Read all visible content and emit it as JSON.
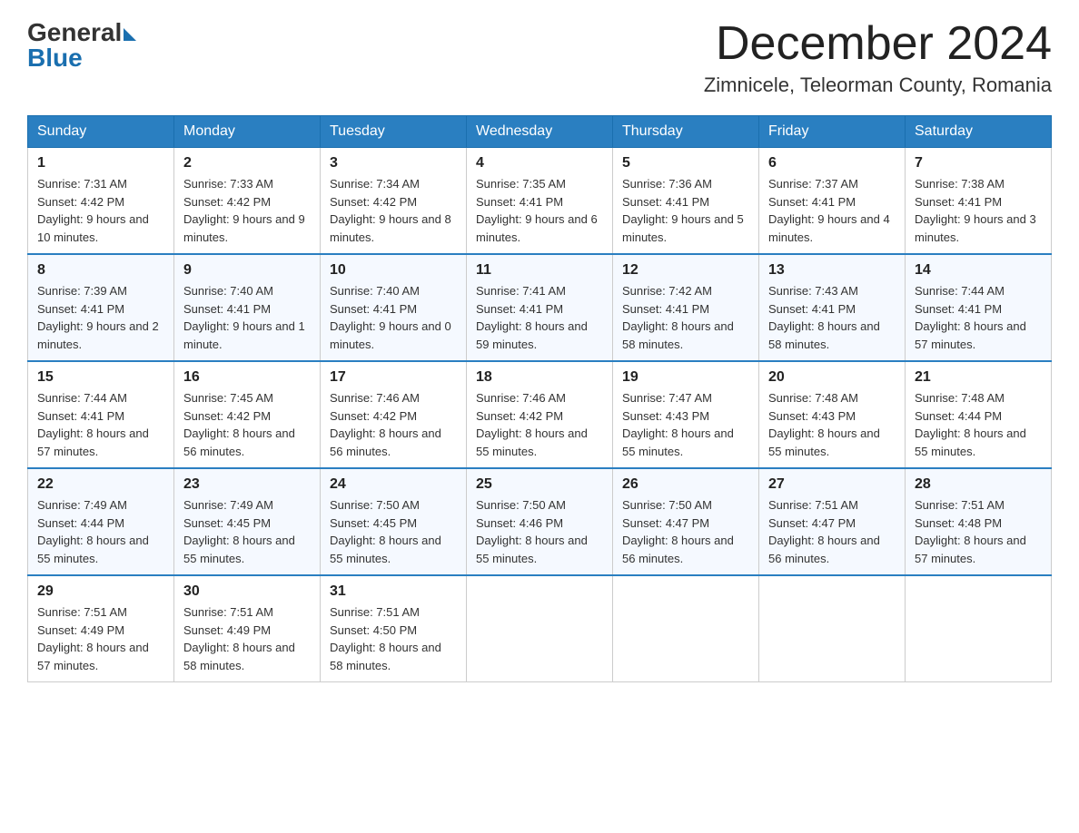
{
  "header": {
    "logo_general": "General",
    "logo_blue": "Blue",
    "month_title": "December 2024",
    "location": "Zimnicele, Teleorman County, Romania"
  },
  "days_of_week": [
    "Sunday",
    "Monday",
    "Tuesday",
    "Wednesday",
    "Thursday",
    "Friday",
    "Saturday"
  ],
  "weeks": [
    [
      {
        "num": "1",
        "sunrise": "7:31 AM",
        "sunset": "4:42 PM",
        "daylight": "9 hours and 10 minutes."
      },
      {
        "num": "2",
        "sunrise": "7:33 AM",
        "sunset": "4:42 PM",
        "daylight": "9 hours and 9 minutes."
      },
      {
        "num": "3",
        "sunrise": "7:34 AM",
        "sunset": "4:42 PM",
        "daylight": "9 hours and 8 minutes."
      },
      {
        "num": "4",
        "sunrise": "7:35 AM",
        "sunset": "4:41 PM",
        "daylight": "9 hours and 6 minutes."
      },
      {
        "num": "5",
        "sunrise": "7:36 AM",
        "sunset": "4:41 PM",
        "daylight": "9 hours and 5 minutes."
      },
      {
        "num": "6",
        "sunrise": "7:37 AM",
        "sunset": "4:41 PM",
        "daylight": "9 hours and 4 minutes."
      },
      {
        "num": "7",
        "sunrise": "7:38 AM",
        "sunset": "4:41 PM",
        "daylight": "9 hours and 3 minutes."
      }
    ],
    [
      {
        "num": "8",
        "sunrise": "7:39 AM",
        "sunset": "4:41 PM",
        "daylight": "9 hours and 2 minutes."
      },
      {
        "num": "9",
        "sunrise": "7:40 AM",
        "sunset": "4:41 PM",
        "daylight": "9 hours and 1 minute."
      },
      {
        "num": "10",
        "sunrise": "7:40 AM",
        "sunset": "4:41 PM",
        "daylight": "9 hours and 0 minutes."
      },
      {
        "num": "11",
        "sunrise": "7:41 AM",
        "sunset": "4:41 PM",
        "daylight": "8 hours and 59 minutes."
      },
      {
        "num": "12",
        "sunrise": "7:42 AM",
        "sunset": "4:41 PM",
        "daylight": "8 hours and 58 minutes."
      },
      {
        "num": "13",
        "sunrise": "7:43 AM",
        "sunset": "4:41 PM",
        "daylight": "8 hours and 58 minutes."
      },
      {
        "num": "14",
        "sunrise": "7:44 AM",
        "sunset": "4:41 PM",
        "daylight": "8 hours and 57 minutes."
      }
    ],
    [
      {
        "num": "15",
        "sunrise": "7:44 AM",
        "sunset": "4:41 PM",
        "daylight": "8 hours and 57 minutes."
      },
      {
        "num": "16",
        "sunrise": "7:45 AM",
        "sunset": "4:42 PM",
        "daylight": "8 hours and 56 minutes."
      },
      {
        "num": "17",
        "sunrise": "7:46 AM",
        "sunset": "4:42 PM",
        "daylight": "8 hours and 56 minutes."
      },
      {
        "num": "18",
        "sunrise": "7:46 AM",
        "sunset": "4:42 PM",
        "daylight": "8 hours and 55 minutes."
      },
      {
        "num": "19",
        "sunrise": "7:47 AM",
        "sunset": "4:43 PM",
        "daylight": "8 hours and 55 minutes."
      },
      {
        "num": "20",
        "sunrise": "7:48 AM",
        "sunset": "4:43 PM",
        "daylight": "8 hours and 55 minutes."
      },
      {
        "num": "21",
        "sunrise": "7:48 AM",
        "sunset": "4:44 PM",
        "daylight": "8 hours and 55 minutes."
      }
    ],
    [
      {
        "num": "22",
        "sunrise": "7:49 AM",
        "sunset": "4:44 PM",
        "daylight": "8 hours and 55 minutes."
      },
      {
        "num": "23",
        "sunrise": "7:49 AM",
        "sunset": "4:45 PM",
        "daylight": "8 hours and 55 minutes."
      },
      {
        "num": "24",
        "sunrise": "7:50 AM",
        "sunset": "4:45 PM",
        "daylight": "8 hours and 55 minutes."
      },
      {
        "num": "25",
        "sunrise": "7:50 AM",
        "sunset": "4:46 PM",
        "daylight": "8 hours and 55 minutes."
      },
      {
        "num": "26",
        "sunrise": "7:50 AM",
        "sunset": "4:47 PM",
        "daylight": "8 hours and 56 minutes."
      },
      {
        "num": "27",
        "sunrise": "7:51 AM",
        "sunset": "4:47 PM",
        "daylight": "8 hours and 56 minutes."
      },
      {
        "num": "28",
        "sunrise": "7:51 AM",
        "sunset": "4:48 PM",
        "daylight": "8 hours and 57 minutes."
      }
    ],
    [
      {
        "num": "29",
        "sunrise": "7:51 AM",
        "sunset": "4:49 PM",
        "daylight": "8 hours and 57 minutes."
      },
      {
        "num": "30",
        "sunrise": "7:51 AM",
        "sunset": "4:49 PM",
        "daylight": "8 hours and 58 minutes."
      },
      {
        "num": "31",
        "sunrise": "7:51 AM",
        "sunset": "4:50 PM",
        "daylight": "8 hours and 58 minutes."
      },
      null,
      null,
      null,
      null
    ]
  ],
  "labels": {
    "sunrise": "Sunrise:",
    "sunset": "Sunset:",
    "daylight": "Daylight:"
  }
}
